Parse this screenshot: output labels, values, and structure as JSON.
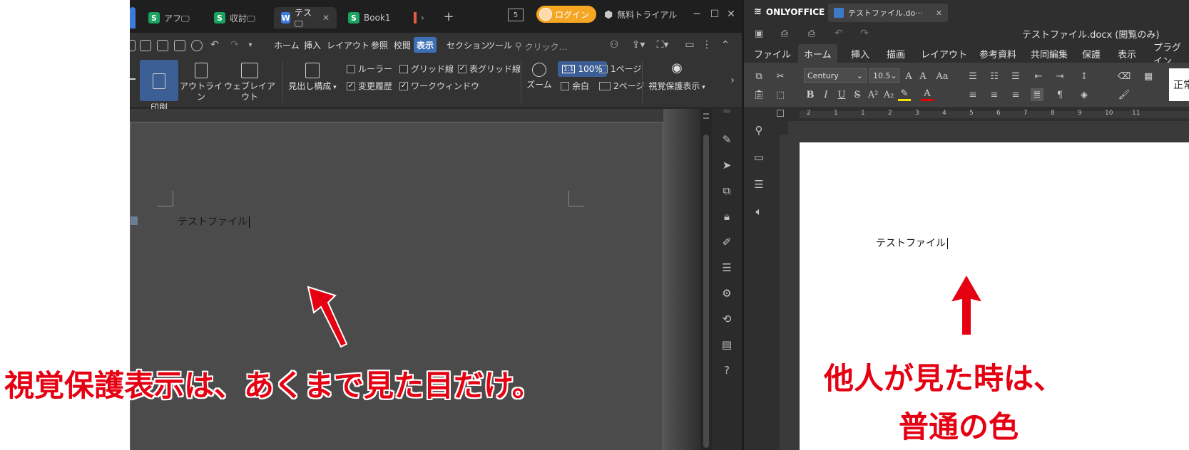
{
  "wps": {
    "tabs": [
      {
        "icon": "S",
        "label": "アフ🖵",
        "color": "#1aa260"
      },
      {
        "icon": "S",
        "label": "収討🖵",
        "color": "#1aa260"
      },
      {
        "icon": "W",
        "label": "テス🖵",
        "color": "#3d7be0",
        "active": true
      },
      {
        "icon": "S",
        "label": "Book1",
        "color": "#1aa260"
      }
    ],
    "new_tab": "+",
    "tab_count": "5",
    "login": "ログイン",
    "trial": "無料トライアル",
    "menus": [
      "ホーム",
      "挿入",
      "レイアウト",
      "参照",
      "校閲",
      "表示",
      "セクション",
      "ツール"
    ],
    "active_menu": "表示",
    "search_placeholder": "クリック…",
    "ribbon": {
      "print_layout": "印刷\nレイアウト",
      "outline": "アウトライン",
      "web_layout": "ウェブレイアウト",
      "heading_structure": "見出し構成",
      "ruler": "ルーラー",
      "grid_lines": "グリッド線",
      "table_grid": "表グリッド線",
      "track_changes": "変更履歴",
      "work_window": "ワークウィンドウ",
      "zoom": "ズーム",
      "zoom_100": "100%",
      "margin": "余白",
      "one_page": "1ページ",
      "two_page": "2ページ",
      "eye_protection": "視覚保護表示"
    },
    "doc_text": "テストファイル"
  },
  "onlyoffice": {
    "brand": "ONLYOFFICE",
    "file_tab": "テストファイル.do···",
    "title": "テストファイル.docx (閲覧のみ)",
    "tabs": [
      "ファイル",
      "ホーム",
      "挿入",
      "描画",
      "レイアウト",
      "参考資料",
      "共同編集",
      "保護",
      "表示",
      "プラグイン"
    ],
    "active_tab": "ホーム",
    "font_name": "Century",
    "font_size": "10.5",
    "style_preview": "正常",
    "doc_text": "テストファイル",
    "ruler_marks": [
      "2",
      "1",
      "1",
      "2",
      "3",
      "4",
      "5",
      "6",
      "7",
      "8",
      "9",
      "10",
      "11"
    ]
  },
  "annotations": {
    "left": "視覚保護表示は、あくまで見た目だけ。",
    "right_line1": "他人が見た時は、",
    "right_line2": "普通の色",
    "color": "#e50012"
  }
}
